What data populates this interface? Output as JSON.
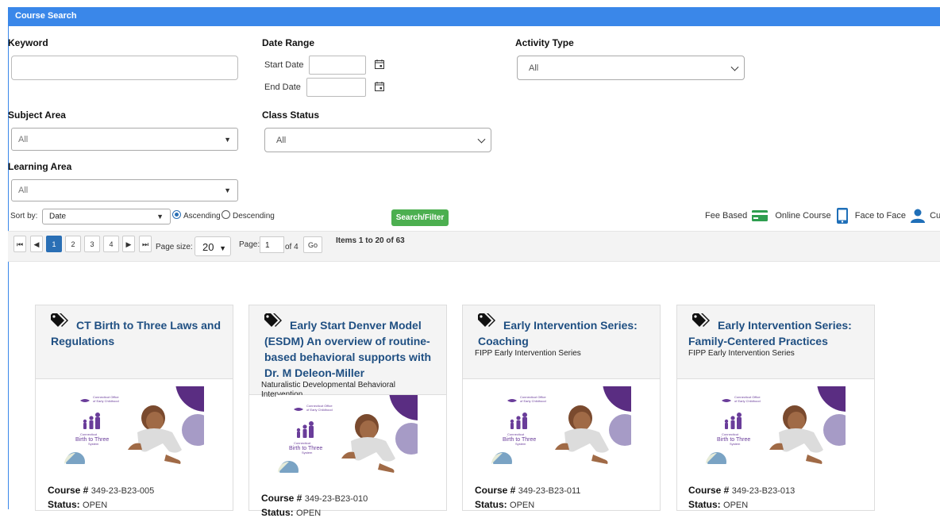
{
  "header": {
    "title": "Course Search"
  },
  "filters": {
    "keyword_label": "Keyword",
    "keyword_value": "",
    "date_range_label": "Date Range",
    "start_date_label": "Start Date",
    "end_date_label": "End Date",
    "activity_type_label": "Activity Type",
    "activity_type_value": "All",
    "subject_area_label": "Subject Area",
    "subject_area_value": "All",
    "class_status_label": "Class Status",
    "class_status_value": "All",
    "learning_area_label": "Learning Area",
    "learning_area_value": "All",
    "sort_by_label": "Sort by:",
    "sort_by_value": "Date",
    "ascending_label": "Ascending",
    "descending_label": "Descending",
    "search_button": "Search/Filter"
  },
  "legend": {
    "fee_based": "Fee Based",
    "online_course": "Online Course",
    "face_to_face": "Face to Face",
    "current": "Curre",
    "colors": {
      "fee": "#2e9e4f",
      "online": "#1f6fb8",
      "face": "#1f6fb8"
    }
  },
  "pager": {
    "pages": [
      "1",
      "2",
      "3",
      "4"
    ],
    "first_icon": "first-page-icon",
    "prev_icon": "prev-page-icon",
    "next_icon": "next-page-icon",
    "last_icon": "last-page-icon",
    "page_size_label": "Page size:",
    "page_size_value": "20",
    "page_label": "Page:",
    "page_value": "1",
    "of_label": "of 4",
    "go_label": "Go",
    "items_text": "Items 1 to 20 of 63"
  },
  "cards": [
    {
      "title": "CT Birth to Three Laws and Regulations",
      "subtitle": "",
      "course_label": "Course #",
      "course_no": "349-23-B23-005",
      "status_label": "Status:",
      "status": "OPEN"
    },
    {
      "title": "Early Start Denver Model (ESDM) An overview of routine-based behavioral supports with Dr. M Deleon-Miller",
      "subtitle": "Naturalistic Developmental Behavioral Intervention",
      "course_label": "Course #",
      "course_no": "349-23-B23-010",
      "status_label": "Status:",
      "status": "OPEN"
    },
    {
      "title": "Early Intervention Series: Coaching",
      "subtitle": "FIPP Early Intervention Series",
      "course_label": "Course #",
      "course_no": "349-23-B23-011",
      "status_label": "Status:",
      "status": "OPEN"
    },
    {
      "title": "Early Intervention Series: Family-Centered Practices",
      "subtitle": "FIPP Early Intervention Series",
      "course_label": "Course #",
      "course_no": "349-23-B23-013",
      "status_label": "Status:",
      "status": "OPEN"
    }
  ],
  "card_image": {
    "org_line1": "Connecticut Office",
    "org_line2": "of Early Childhood",
    "logo_line1": "Connecticut",
    "logo_line2": "Birth to Three",
    "logo_line3": "System"
  }
}
